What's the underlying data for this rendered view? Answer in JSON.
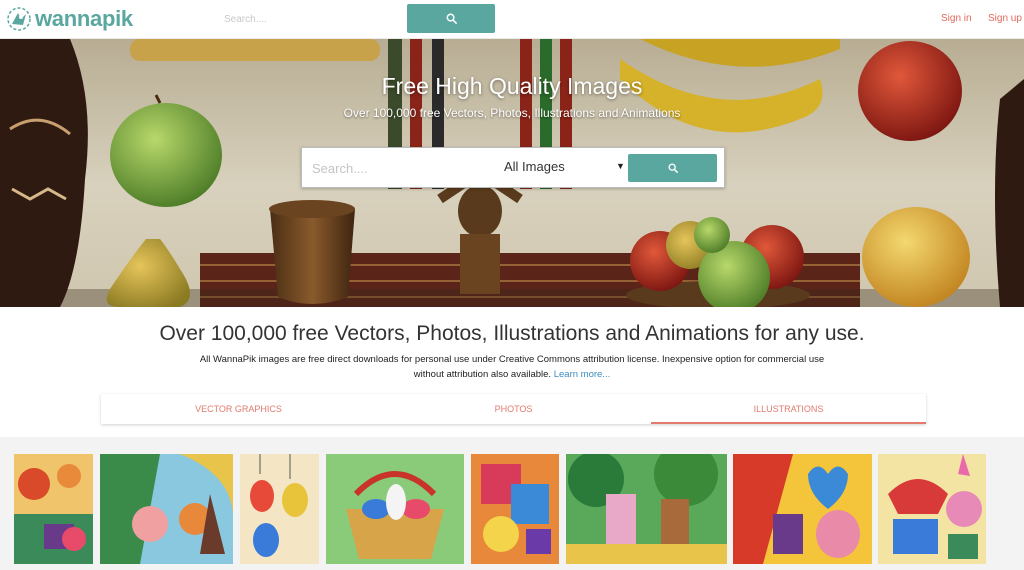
{
  "header": {
    "logo_text": "wannapik",
    "search_placeholder": "Search....",
    "sign_in": "Sign in",
    "sign_up": "Sign up"
  },
  "hero": {
    "title": "Free High Quality Images",
    "subtitle": "Over 100,000 free Vectors, Photos, Illustrations and Animations",
    "search_placeholder": "Search....",
    "category_selected": "All Images"
  },
  "intro": {
    "headline": "Over 100,000 free Vectors, Photos, Illustrations and Animations for any use.",
    "description": "All WannaPik images are free direct downloads for personal use under Creative Commons attribution license. Inexpensive option for commercial use without attribution also available.",
    "learn_more": "Learn more..."
  },
  "tabs": [
    {
      "label": "VECTOR GRAPHICS",
      "active": false
    },
    {
      "label": "PHOTOS",
      "active": false
    },
    {
      "label": "ILLUSTRATIONS",
      "active": true
    }
  ],
  "colors": {
    "accent_teal": "#5aa7a0",
    "link_salmon": "#e06a5a",
    "learn_more_blue": "#3b8dc1"
  },
  "icons": [
    "wannapik-logo-icon",
    "search-icon",
    "caret-down-icon"
  ]
}
